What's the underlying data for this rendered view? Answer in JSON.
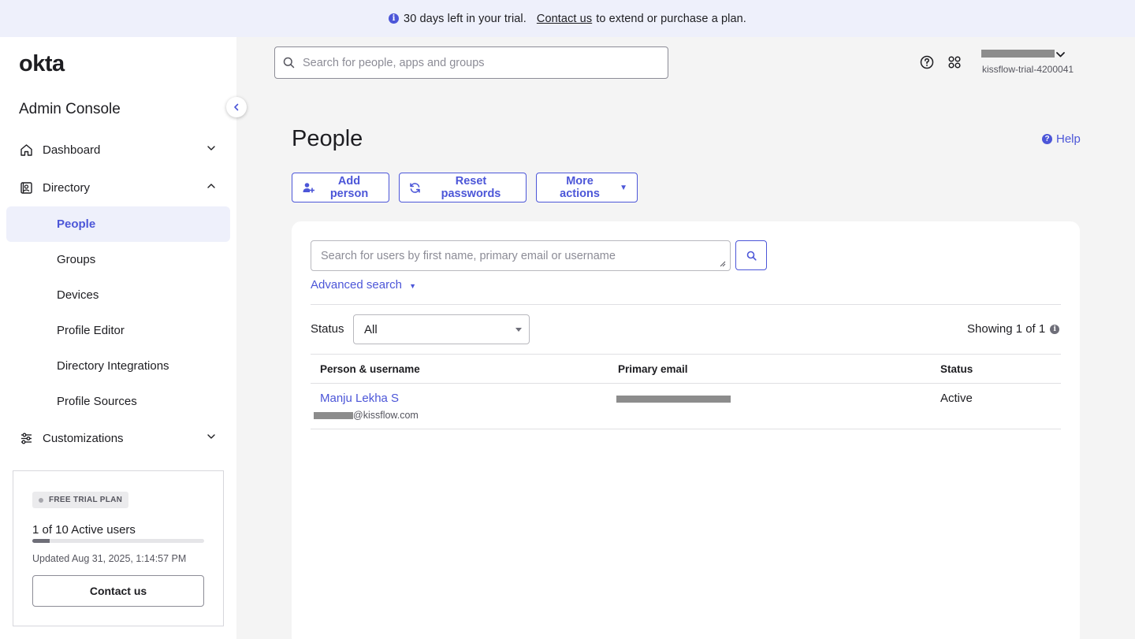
{
  "banner": {
    "text": "30 days left in your trial.",
    "link": "Contact us",
    "suffix": "to extend or purchase a plan.",
    "info_icon": "info-icon"
  },
  "sidebar": {
    "logo": "okta",
    "title": "Admin Console",
    "items": [
      {
        "label": "Dashboard",
        "icon": "home-icon",
        "expanded": false
      },
      {
        "label": "Directory",
        "icon": "directory-icon",
        "expanded": true
      },
      {
        "label": "Customizations",
        "icon": "sliders-icon",
        "expanded": false
      }
    ],
    "directory_subitems": [
      {
        "label": "People",
        "active": true
      },
      {
        "label": "Groups",
        "active": false
      },
      {
        "label": "Devices",
        "active": false
      },
      {
        "label": "Profile Editor",
        "active": false
      },
      {
        "label": "Directory Integrations",
        "active": false
      },
      {
        "label": "Profile Sources",
        "active": false
      }
    ],
    "plan": {
      "badge": "FREE TRIAL PLAN",
      "users": "1 of 10 Active users",
      "progress_fraction": 0.1,
      "updated": "Updated Aug 31, 2025, 1:14:57 PM",
      "contact_label": "Contact us"
    }
  },
  "header": {
    "search_placeholder": "Search for people, apps and groups",
    "org": "kissflow-trial-4200041"
  },
  "main": {
    "title": "People",
    "help": "Help",
    "actions": {
      "add_person": "Add person",
      "reset_passwords": "Reset passwords",
      "more_actions": "More actions"
    },
    "user_search_placeholder": "Search for users by first name, primary email or username",
    "advanced_search": "Advanced search",
    "status_label": "Status",
    "status_value": "All",
    "showing": "Showing 1 of 1",
    "table": {
      "headers": [
        "Person & username",
        "Primary email",
        "Status"
      ],
      "rows": [
        {
          "name": "Manju Lekha S",
          "username_suffix": "@kissflow.com",
          "status": "Active"
        }
      ]
    }
  },
  "colors": {
    "accent": "#4c56d8",
    "banner_bg": "#eef0fb",
    "page_bg": "#f4f4f4"
  }
}
